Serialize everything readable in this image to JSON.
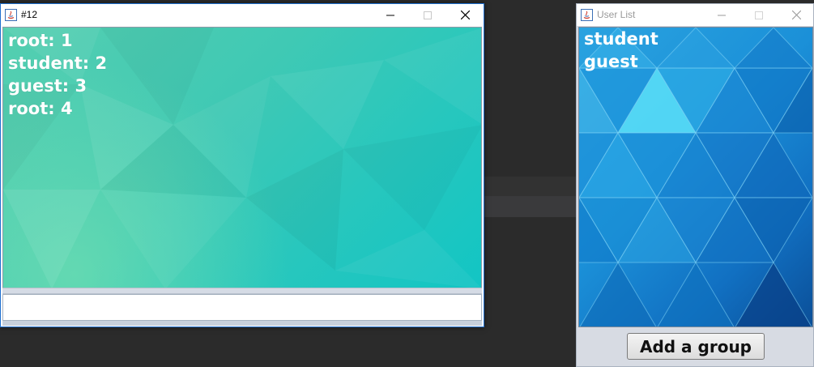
{
  "chat_window": {
    "title": "#12",
    "messages": [
      "root: 1",
      "student: 2",
      "guest: 3",
      "root: 4"
    ],
    "input": {
      "value": "",
      "placeholder": ""
    },
    "icons": [
      "java-icon",
      "minimize-icon",
      "maximize-icon",
      "close-icon"
    ]
  },
  "user_window": {
    "title": "User List",
    "users": [
      "student",
      "guest"
    ],
    "add_group_label": "Add a group",
    "icons": [
      "java-icon",
      "minimize-icon",
      "maximize-icon",
      "close-icon"
    ]
  },
  "colors": {
    "chat_bg_start": "#55cfb0",
    "chat_bg_end": "#12c5c4",
    "user_bg_start": "#2aa3e0",
    "user_bg_end": "#0b4f98",
    "active_border": "#1e6fd0"
  }
}
